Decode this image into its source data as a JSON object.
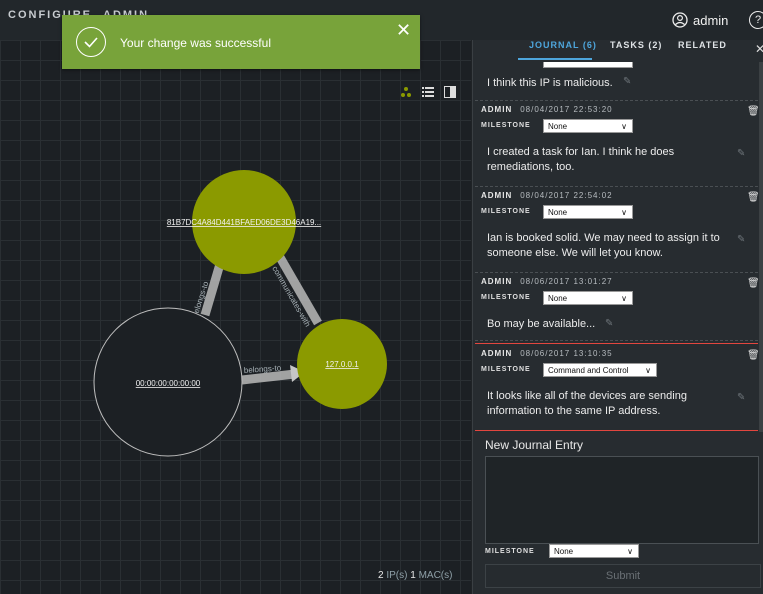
{
  "nav": {
    "configure": "CONFIGURE",
    "admin": "ADMIN",
    "user": "admin",
    "help_glyph": "?"
  },
  "toast": {
    "message": "Your change was successful",
    "close_glyph": "✕",
    "color": "#78a33a"
  },
  "graph": {
    "nodes": [
      {
        "label": "81B7DC4A84D441BFAED06DE3D46A19...",
        "color": "#8b9a00"
      },
      {
        "label": "127.0.0.1",
        "color": "#8b9a00"
      },
      {
        "label": "00:00:00:00:00:00",
        "color": "#1c2024"
      }
    ],
    "edges": [
      {
        "label": "belongs-to"
      },
      {
        "label": "communicates-with"
      },
      {
        "label": "belongs-to"
      }
    ],
    "counts": {
      "ips_num": "2",
      "ips_lbl": "IP(s)",
      "macs_num": "1",
      "macs_lbl": "MAC(s)"
    }
  },
  "panel": {
    "tabs": {
      "journal": "JOURNAL (6)",
      "tasks": "TASKS (2)",
      "related": "RELATED"
    },
    "close_glyph": "✕",
    "milestone_label": "MILESTONE",
    "entries": [
      {
        "author": "",
        "timestamp": "",
        "milestone": "",
        "text": "I think this IP is malicious."
      },
      {
        "author": "ADMIN",
        "timestamp": "08/04/2017 22:53:20",
        "milestone": "None",
        "text": "I created a task for Ian. I think he does remediations, too."
      },
      {
        "author": "ADMIN",
        "timestamp": "08/04/2017 22:54:02",
        "milestone": "None",
        "text": "Ian is booked solid. We may need to assign it to someone else. We will let you know."
      },
      {
        "author": "ADMIN",
        "timestamp": "08/06/2017 13:01:27",
        "milestone": "None",
        "text": "Bo may be available..."
      },
      {
        "author": "ADMIN",
        "timestamp": "08/06/2017 13:10:35",
        "milestone": "Command and Control",
        "text": "It looks like all of the devices are sending information to the same IP address."
      }
    ],
    "new_entry": {
      "label": "New Journal Entry",
      "milestone_label": "MILESTONE",
      "milestone_value": "None",
      "submit": "Submit"
    },
    "accent_color": "#4ea6dc",
    "highlight_color": "#e2463f"
  }
}
